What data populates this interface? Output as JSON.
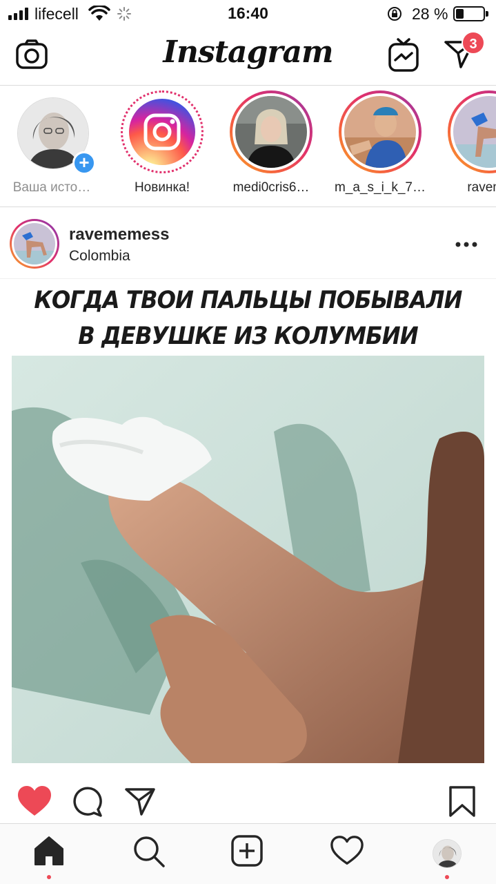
{
  "status_bar": {
    "carrier": "lifecell",
    "time": "16:40",
    "battery_percent": "28 %",
    "battery_level": 0.28
  },
  "top_nav": {
    "logo": "Instagram",
    "direct_badge_count": "3",
    "icons": [
      "camera-icon",
      "igtv-icon",
      "direct-message-icon"
    ]
  },
  "stories": [
    {
      "label": "Ваша исто…",
      "type": "own"
    },
    {
      "label": "Новинка!",
      "type": "new"
    },
    {
      "label": "medi0cris6…",
      "type": "story"
    },
    {
      "label": "m_a_s_i_k_7…",
      "type": "story"
    },
    {
      "label": "raveme",
      "type": "story"
    }
  ],
  "post": {
    "username": "ravememess",
    "location": "Colombia",
    "caption_lines": [
      "КОГДА ТВОИ ПАЛЬЦЫ ПОБЫВАЛИ",
      "В ДЕВУШКЕ ИЗ КОЛУМБИИ"
    ],
    "liked": true
  },
  "colors": {
    "like_red": "#ed4956",
    "accent_blue": "#3897f0",
    "border": "#dbdbdb"
  },
  "tab_bar": [
    "home-icon",
    "search-icon",
    "new-post-icon",
    "activity-icon",
    "profile-avatar"
  ]
}
